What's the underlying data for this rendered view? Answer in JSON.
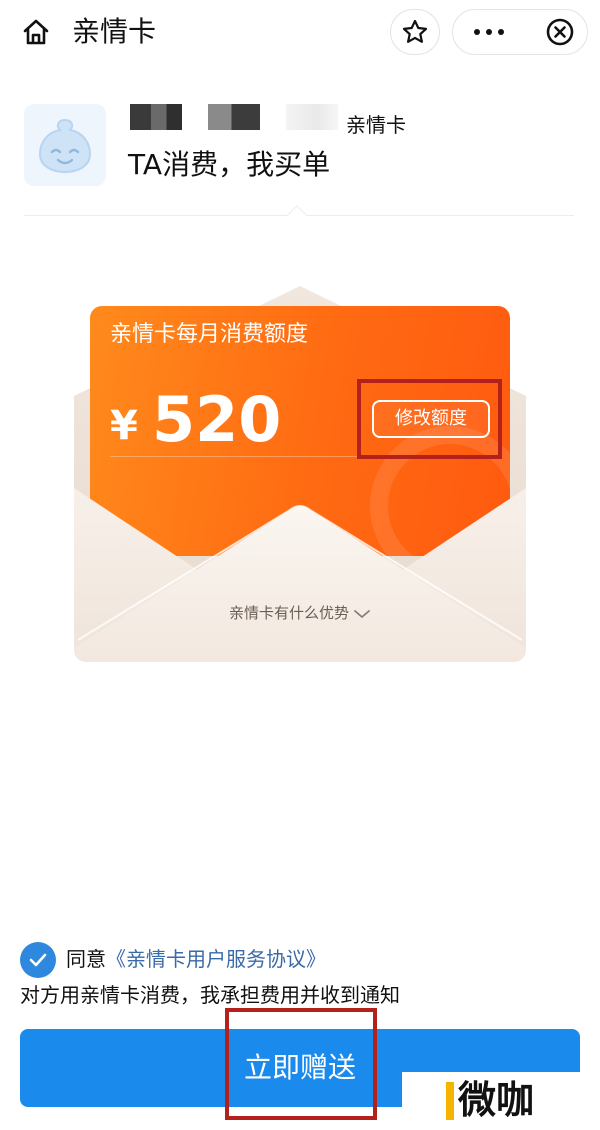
{
  "nav": {
    "title": "亲情卡"
  },
  "header": {
    "card_name": "亲情卡",
    "slogan": "TA消费，我买单"
  },
  "card": {
    "title": "亲情卡每月消费额度",
    "currency": "¥",
    "amount": "520",
    "modify_label": "修改额度",
    "advantage_label": "亲情卡有什么优势"
  },
  "agreement": {
    "agree_prefix": "同意",
    "agree_link": "《亲情卡用户服务协议》",
    "notice": "对方用亲情卡消费，我承担费用并收到通知",
    "checked": true
  },
  "submit": {
    "label": "立即赠送"
  },
  "watermark": {
    "text": "微咖"
  },
  "colors": {
    "accent_blue": "#1a8bec",
    "card_orange": "#ff6a12",
    "highlight_red": "#b3211d",
    "link_blue": "#3a6aa8"
  },
  "icons": [
    "home-icon",
    "star-icon",
    "more-icon",
    "close-icon",
    "check-icon",
    "chevron-down-icon",
    "mascot-avatar"
  ]
}
